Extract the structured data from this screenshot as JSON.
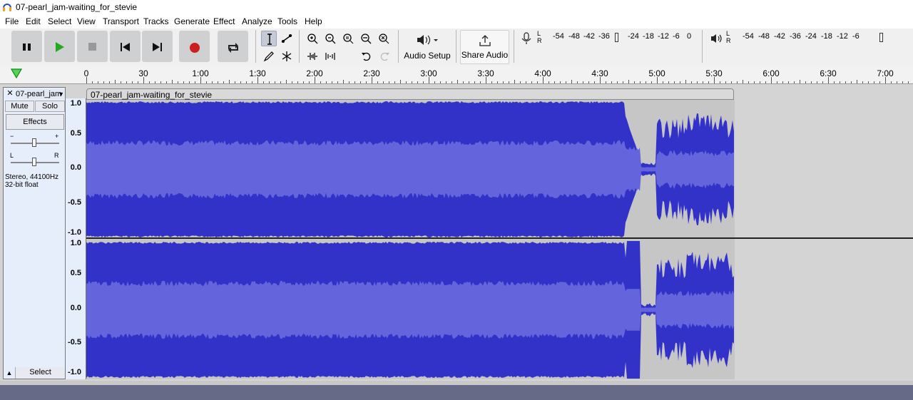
{
  "window": {
    "title": "07-pearl_jam-waiting_for_stevie"
  },
  "menu": [
    "File",
    "Edit",
    "Select",
    "View",
    "Transport",
    "Tracks",
    "Generate",
    "Effect",
    "Analyze",
    "Tools",
    "Help"
  ],
  "toolbar": {
    "audio_setup_label": "Audio Setup",
    "share_audio_label": "Share Audio",
    "rec_meter": {
      "input_channels": "L R",
      "ticks": [
        "-54",
        "-48",
        "-42",
        "-36",
        "-24",
        "-18",
        "-12",
        "-6",
        "0"
      ]
    },
    "play_meter": {
      "channels": "L R",
      "ticks": [
        "-54",
        "-48",
        "-42",
        "-36",
        "-24",
        "-18",
        "-12",
        "-6"
      ]
    }
  },
  "timeline": {
    "labels": [
      "0",
      "30",
      "1:00",
      "1:30",
      "2:00",
      "2:30",
      "3:00",
      "3:30",
      "4:00",
      "4:30",
      "5:00",
      "5:30",
      "6:00",
      "6:30",
      "7:00"
    ]
  },
  "track": {
    "name": "07-pearl_jam",
    "mute_label": "Mute",
    "solo_label": "Solo",
    "effects_label": "Effects",
    "gain_minus": "−",
    "gain_plus": "+",
    "pan_left": "L",
    "pan_right": "R",
    "info_line1": "Stereo, 44100Hz",
    "info_line2": "32-bit float",
    "select_label": "Select",
    "collapse_glyph": "▲",
    "close_glyph": "✕",
    "dropdown_glyph": "▼"
  },
  "clip": {
    "title": "07-pearl_jam-waiting_for_stevie"
  },
  "vruler": {
    "channel1": [
      "1.0",
      "0.5",
      "0.0",
      "-0.5",
      "-1.0"
    ],
    "channel2": [
      "1.0",
      "0.5",
      "0.0",
      "-0.5",
      "-1.0"
    ]
  },
  "colors": {
    "wave_peak": "#3232c8",
    "wave_rms": "#6464dc",
    "clip_bg": "#c6c6c6",
    "track_bg": "#d4d4d4"
  }
}
